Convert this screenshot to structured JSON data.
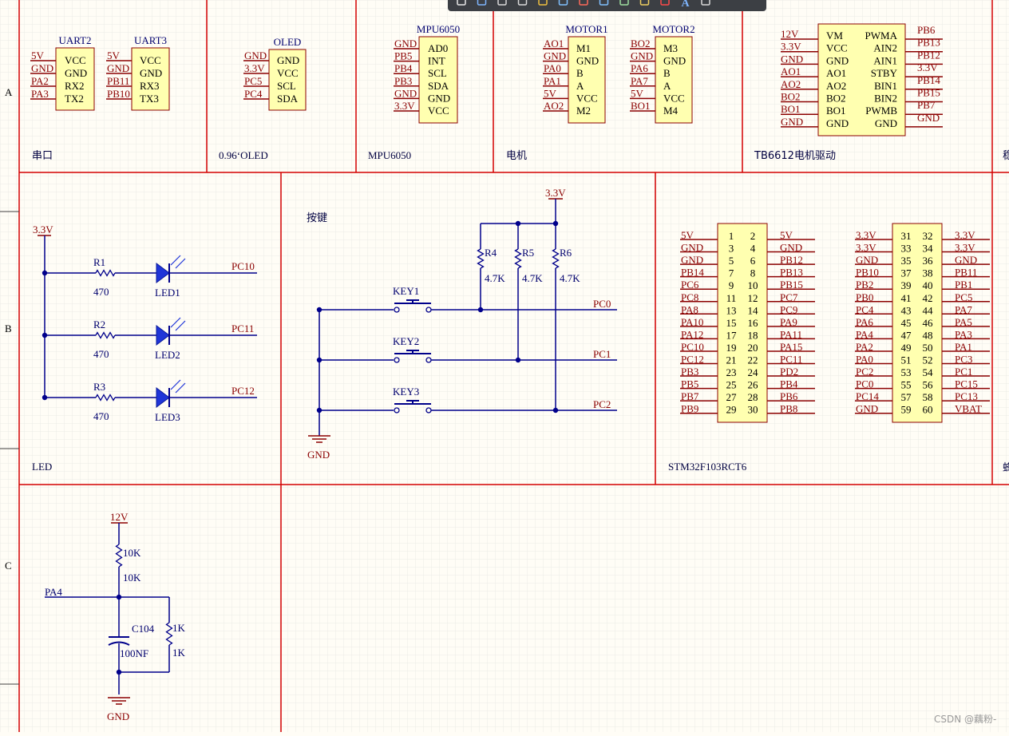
{
  "colors": {
    "background": "#fffdf6",
    "grid": "#e6e6e6",
    "border_line": "#d40000",
    "net_label": "#8b0000",
    "wire": "#00008b",
    "component_fill": "#ffffb0",
    "component_outline": "#8b0000",
    "pin_text": "#000000",
    "ref_text": "#00006e"
  },
  "toolbar": {
    "icons": [
      "filter-icon",
      "add-icon",
      "select-rect-icon",
      "align-icon",
      "place-part-icon",
      "wire-icon",
      "gnd-port-icon",
      "bus-icon",
      "component-icon",
      "harness-icon",
      "no-erc-icon",
      "text-icon",
      "more-icon"
    ],
    "text_tool_label": "A"
  },
  "row_labels": [
    "A",
    "B",
    "C"
  ],
  "sections": {
    "uart": "串口",
    "oled": "0.96‘OLED",
    "mpu": "MPU6050",
    "motor": "电机",
    "tb6612": "TB6612电机驱动",
    "cut_right_a": "稳",
    "led": "LED",
    "key": "按键",
    "stm32": "STM32F103RCT6",
    "cut_right_b": "蜂"
  },
  "uart2": {
    "ref": "UART2",
    "nets": [
      "5V",
      "GND",
      "PA2",
      "PA3"
    ],
    "pins": [
      "VCC",
      "GND",
      "RX2",
      "TX2"
    ]
  },
  "uart3": {
    "ref": "UART3",
    "nets": [
      "5V",
      "GND",
      "PB11",
      "PB10"
    ],
    "pins": [
      "VCC",
      "GND",
      "RX3",
      "TX3"
    ]
  },
  "oled": {
    "ref": "OLED",
    "nets": [
      "GND",
      "3.3V",
      "PC5",
      "PC4"
    ],
    "pins": [
      "GND",
      "VCC",
      "SCL",
      "SDA"
    ]
  },
  "mpu6050": {
    "ref": "MPU6050",
    "nets": [
      "GND",
      "PB5",
      "PB4",
      "PB3",
      "GND",
      "3.3V"
    ],
    "pins": [
      "AD0",
      "INT",
      "SCL",
      "SDA",
      "GND",
      "VCC"
    ]
  },
  "motor1": {
    "ref": "MOTOR1",
    "nets": [
      "AO1",
      "GND",
      "PA0",
      "PA1",
      "5V",
      "AO2"
    ],
    "pins": [
      "M1",
      "GND",
      "B",
      "A",
      "VCC",
      "M2"
    ]
  },
  "motor2": {
    "ref": "MOTOR2",
    "nets": [
      "BO2",
      "GND",
      "PA6",
      "PA7",
      "5V",
      "BO1"
    ],
    "pins": [
      "M3",
      "GND",
      "B",
      "A",
      "VCC",
      "M4"
    ]
  },
  "tb6612": {
    "left_nets": [
      "12V",
      "3.3V",
      "GND",
      "AO1",
      "AO2",
      "BO2",
      "BO1",
      "GND"
    ],
    "left_pins": [
      "VM",
      "VCC",
      "GND",
      "AO1",
      "AO2",
      "BO2",
      "BO1",
      "GND"
    ],
    "right_pins": [
      "PWMA",
      "AIN2",
      "AIN1",
      "STBY",
      "BIN1",
      "BIN2",
      "PWMB",
      "GND"
    ],
    "right_nets": [
      "PB6",
      "PB13",
      "PB12",
      "3.3V",
      "PB14",
      "PB15",
      "PB7",
      "GND"
    ]
  },
  "led": {
    "power": "3.3V",
    "rows": [
      {
        "res": "R1",
        "val": "470",
        "led": "LED1",
        "net": "PC10"
      },
      {
        "res": "R2",
        "val": "470",
        "led": "LED2",
        "net": "PC11"
      },
      {
        "res": "R3",
        "val": "470",
        "led": "LED3",
        "net": "PC12"
      }
    ]
  },
  "keys": {
    "power": "3.3V",
    "gnd": "GND",
    "resistors": [
      {
        "ref": "R4",
        "val": "4.7K"
      },
      {
        "ref": "R5",
        "val": "4.7K"
      },
      {
        "ref": "R6",
        "val": "4.7K"
      }
    ],
    "switches": [
      {
        "ref": "KEY1",
        "net": "PC0"
      },
      {
        "ref": "KEY2",
        "net": "PC1"
      },
      {
        "ref": "KEY3",
        "net": "PC2"
      }
    ]
  },
  "stm32_left": {
    "left_nets": [
      "5V",
      "GND",
      "GND",
      "PB14",
      "PC6",
      "PC8",
      "PA8",
      "PA10",
      "PA12",
      "PC10",
      "PC12",
      "PB3",
      "PB5",
      "PB7",
      "PB9"
    ],
    "odd": [
      "1",
      "3",
      "5",
      "7",
      "9",
      "11",
      "13",
      "15",
      "17",
      "19",
      "21",
      "23",
      "25",
      "27",
      "29"
    ],
    "even": [
      "2",
      "4",
      "6",
      "8",
      "10",
      "12",
      "14",
      "16",
      "18",
      "20",
      "22",
      "24",
      "26",
      "28",
      "30"
    ],
    "right_nets": [
      "5V",
      "GND",
      "PB12",
      "PB13",
      "PB15",
      "PC7",
      "PC9",
      "PA9",
      "PA11",
      "PA15",
      "PC11",
      "PD2",
      "PB4",
      "PB6",
      "PB8"
    ]
  },
  "stm32_right": {
    "left_nets": [
      "3.3V",
      "3.3V",
      "GND",
      "PB10",
      "PB2",
      "PB0",
      "PC4",
      "PA6",
      "PA4",
      "PA2",
      "PA0",
      "PC2",
      "PC0",
      "PC14",
      "GND"
    ],
    "odd": [
      "31",
      "33",
      "35",
      "37",
      "39",
      "41",
      "43",
      "45",
      "47",
      "49",
      "51",
      "53",
      "55",
      "57",
      "59"
    ],
    "even": [
      "32",
      "34",
      "36",
      "38",
      "40",
      "42",
      "44",
      "46",
      "48",
      "50",
      "52",
      "54",
      "56",
      "58",
      "60"
    ],
    "right_nets": [
      "3.3V",
      "3.3V",
      "GND",
      "PB11",
      "PB1",
      "PC5",
      "PA7",
      "PA5",
      "PA3",
      "PA1",
      "PC3",
      "PC1",
      "PC15",
      "PC13",
      "VBAT"
    ]
  },
  "battery": {
    "power": "12V",
    "r_top_ref": "10K",
    "r_top_val": "10K",
    "net": "PA4",
    "cap_ref": "C104",
    "cap_val": "100NF",
    "r_side_ref": "1K",
    "r_side_val": "1K",
    "gnd": "GND"
  },
  "watermark": "CSDN @藕粉-"
}
